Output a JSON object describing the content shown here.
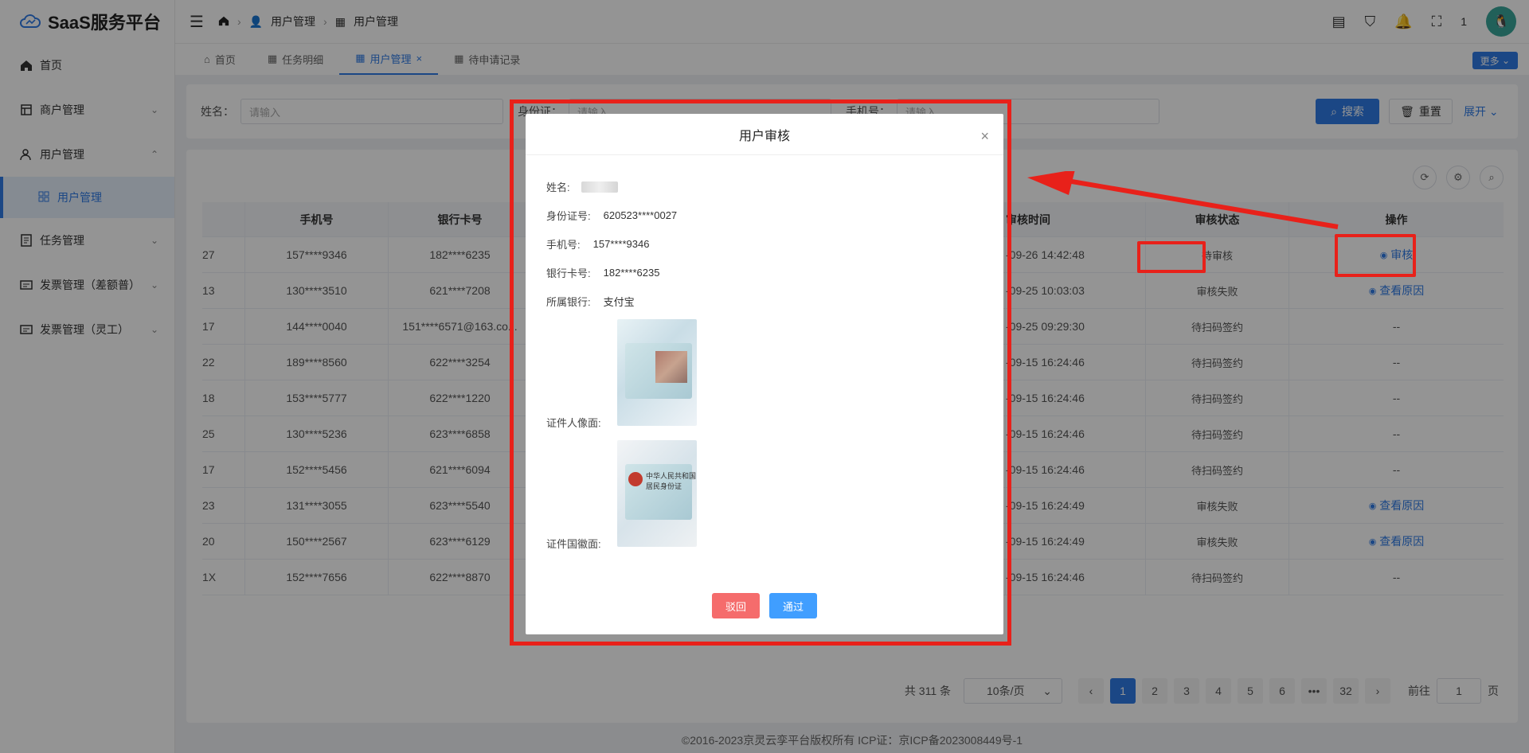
{
  "app": {
    "logo_text": "SaaS服务平台"
  },
  "header": {
    "breadcrumbs": [
      "用户管理",
      "用户管理"
    ],
    "badge_count": "1"
  },
  "sidebar": {
    "items": [
      {
        "label": "首页",
        "icon": "home-icon"
      },
      {
        "label": "商户管理",
        "icon": "shop-icon"
      },
      {
        "label": "用户管理",
        "icon": "user-icon"
      },
      {
        "label": "用户管理",
        "icon": "grid-icon"
      },
      {
        "label": "任务管理",
        "icon": "task-icon"
      },
      {
        "label": "发票管理（差额普）",
        "icon": "invoice-icon"
      },
      {
        "label": "发票管理（灵工）",
        "icon": "invoice-icon"
      }
    ]
  },
  "tabs": [
    {
      "label": "首页"
    },
    {
      "label": "任务明细"
    },
    {
      "label": "用户管理"
    },
    {
      "label": "待申请记录"
    }
  ],
  "more_label": "更多",
  "search": {
    "name_label": "姓名：",
    "id_label": "身份证：",
    "phone_label": "手机号：",
    "placeholder": "请输入",
    "search_btn": "搜索",
    "reset_btn": "重置",
    "expand": "展开"
  },
  "table": {
    "headers": [
      "",
      "手机号",
      "银行卡号",
      "",
      "审核时间",
      "审核状态",
      "操作"
    ],
    "rows": [
      {
        "id_tail": "27",
        "phone": "157****9346",
        "card": "182****6235",
        "time": "-09-26 14:42:48",
        "status": "待审核",
        "action": "审核"
      },
      {
        "id_tail": "13",
        "phone": "130****3510",
        "card": "621****7208",
        "time": "-09-25 10:03:03",
        "status": "审核失败",
        "action": "查看原因"
      },
      {
        "id_tail": "17",
        "phone": "144****0040",
        "card": "151****6571@163.co...",
        "time": "-09-25 09:29:30",
        "status": "待扫码签约",
        "action": "--"
      },
      {
        "id_tail": "22",
        "phone": "189****8560",
        "card": "622****3254",
        "time": "-09-15 16:24:46",
        "status": "待扫码签约",
        "action": "--"
      },
      {
        "id_tail": "18",
        "phone": "153****5777",
        "card": "622****1220",
        "time": "-09-15 16:24:46",
        "status": "待扫码签约",
        "action": "--"
      },
      {
        "id_tail": "25",
        "phone": "130****5236",
        "card": "623****6858",
        "time": "-09-15 16:24:46",
        "status": "待扫码签约",
        "action": "--"
      },
      {
        "id_tail": "17",
        "phone": "152****5456",
        "card": "621****6094",
        "time": "-09-15 16:24:46",
        "status": "待扫码签约",
        "action": "--"
      },
      {
        "id_tail": "23",
        "phone": "131****3055",
        "card": "623****5540",
        "time": "-09-15 16:24:49",
        "status": "审核失败",
        "action": "查看原因"
      },
      {
        "id_tail": "20",
        "phone": "150****2567",
        "card": "623****6129",
        "time": "-09-15 16:24:49",
        "status": "审核失败",
        "action": "查看原因"
      },
      {
        "id_tail": "1X",
        "phone": "152****7656",
        "card": "622****8870",
        "time": "-09-15 16:24:46",
        "status": "待扫码签约",
        "action": "--"
      }
    ]
  },
  "pager": {
    "total": "共 311 条",
    "page_size": "10条/页",
    "pages": [
      "1",
      "2",
      "3",
      "4",
      "5",
      "6",
      "•••",
      "32"
    ],
    "goto_label": "前往",
    "goto_value": "1",
    "page_suffix": "页"
  },
  "footer": "©2016-2023京灵云孪平台版权所有 ICP证：京ICP备2023008449号-1",
  "modal": {
    "title": "用户审核",
    "name_label": "姓名:",
    "id_label": "身份证号:",
    "id_value": "620523****0027",
    "phone_label": "手机号:",
    "phone_value": "157****9346",
    "card_label": "银行卡号:",
    "card_value": "182****6235",
    "bank_label": "所属银行:",
    "bank_value": "支付宝",
    "front_label": "证件人像面:",
    "back_label": "证件国徽面:",
    "back_text": "中华人民共和国 居民身份证",
    "reject": "驳回",
    "pass": "通过"
  },
  "colors": {
    "primary": "#2f7be6",
    "danger": "#f56c6c",
    "annotation": "#e8211a"
  }
}
